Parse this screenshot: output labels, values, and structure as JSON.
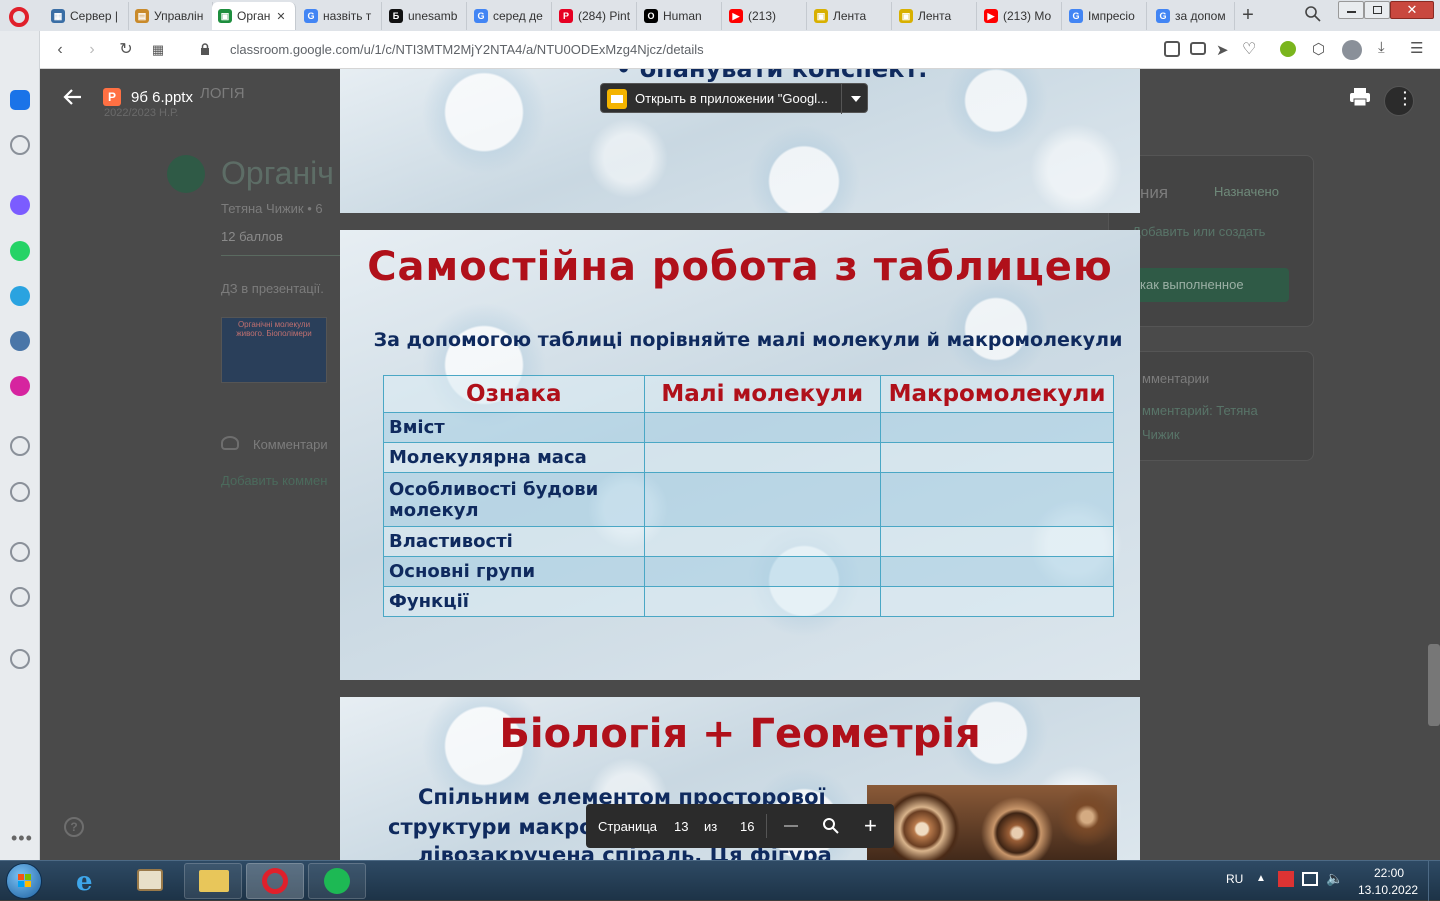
{
  "browser": {
    "tabs": [
      {
        "label": "Сервер |",
        "color": "#3a6ea5",
        "glyph": "▦"
      },
      {
        "label": "Управлін",
        "color": "#c98a2a",
        "glyph": "▤"
      },
      {
        "label": "Орган",
        "color": "#1e8e3e",
        "glyph": "▣",
        "active": true
      },
      {
        "label": "назвіть т",
        "color": "#4285f4",
        "glyph": "G"
      },
      {
        "label": "unesamb",
        "color": "#111111",
        "glyph": "Б"
      },
      {
        "label": "серед де",
        "color": "#4285f4",
        "glyph": "G"
      },
      {
        "label": "(284) Pint",
        "color": "#e60023",
        "glyph": "P"
      },
      {
        "label": "Human",
        "color": "#000000",
        "glyph": "O"
      },
      {
        "label": "(213)",
        "color": "#ff0000",
        "glyph": "▶"
      },
      {
        "label": "Лента",
        "color": "#d8b000",
        "glyph": "▣"
      },
      {
        "label": "Лента",
        "color": "#d8b000",
        "glyph": "▣"
      },
      {
        "label": "(213) Мо",
        "color": "#ff0000",
        "glyph": "▶"
      },
      {
        "label": "Імпресіо",
        "color": "#4285f4",
        "glyph": "G"
      },
      {
        "label": "за допом",
        "color": "#4285f4",
        "glyph": "G"
      }
    ],
    "url": "classroom.google.com/u/1/c/NTI3MTM2MjY2NTA4/a/NTU0ODExMzg4Njcz/details"
  },
  "sidebar": {
    "icons": [
      {
        "name": "home-icon",
        "color": "#1a73e8"
      },
      {
        "name": "star-icon",
        "color": "#8a9099"
      },
      {
        "name": "messenger-icon",
        "color": "#7b5cff"
      },
      {
        "name": "whatsapp-icon",
        "color": "#25d366"
      },
      {
        "name": "telegram-icon",
        "color": "#2aa3e0"
      },
      {
        "name": "vk-icon",
        "color": "#4a76a8"
      },
      {
        "name": "instagram-icon",
        "color": "#d6249f"
      },
      {
        "name": "player-icon",
        "color": "#8a9099"
      },
      {
        "name": "send-icon",
        "color": "#8a9099"
      },
      {
        "name": "heart-icon",
        "color": "#8a9099"
      },
      {
        "name": "history-icon",
        "color": "#8a9099"
      },
      {
        "name": "bulb-icon",
        "color": "#8a9099"
      }
    ]
  },
  "viewer": {
    "filename": "9б 6.pptx",
    "open_with_label": "Открыть в приложении \"Googl...",
    "pager": {
      "page_label": "Страница",
      "current": "13",
      "of_label": "из",
      "total": "16"
    }
  },
  "background_page": {
    "course_fragment": "ЛОГІЯ",
    "year": "2022/2023 Н.Р.",
    "title": "Органіч",
    "author": "Тетяна Чижик • 6",
    "points": "12 баллов",
    "desc": "ДЗ в презентації.",
    "thumb_text": "Органічні молекули живого. Біополімери",
    "comments_label": "Комментари",
    "add_comment": "Добавить коммен",
    "status_fragment": "ния",
    "status_value": "Назначено",
    "add_create": "Добавить или создать",
    "mark_done": "как выполненное",
    "comments_right": "мментарии",
    "comment_by": "мментарий: Тетяна",
    "comment_name": "Чижик"
  },
  "slide_prev": {
    "bullet_text": "• опанувати конспект."
  },
  "slide_main": {
    "title": "Самостійна робота з таблицею",
    "subtitle": "За допомогою таблиці порівняйте малі молекули й макромолекули",
    "table": {
      "headers": [
        "Ознака",
        "Малі молекули",
        "Макромолекули"
      ],
      "rows": [
        [
          "Вміст",
          "",
          ""
        ],
        [
          "Молекулярна маса",
          "",
          ""
        ],
        [
          "Особливості будови молекул",
          "",
          ""
        ],
        [
          "Властивості",
          "",
          ""
        ],
        [
          "Основні групи",
          "",
          ""
        ],
        [
          "Функції",
          "",
          ""
        ]
      ]
    }
  },
  "slide_next": {
    "title": "Біологія + Геометрія",
    "line1": "Спільним елементом просторової",
    "line2": "структури макромолекул є право- або",
    "line3": "лівозакручена спіраль. Ця фігура"
  },
  "taskbar": {
    "lang": "RU",
    "time": "22:00",
    "date": "13.10.2022"
  }
}
